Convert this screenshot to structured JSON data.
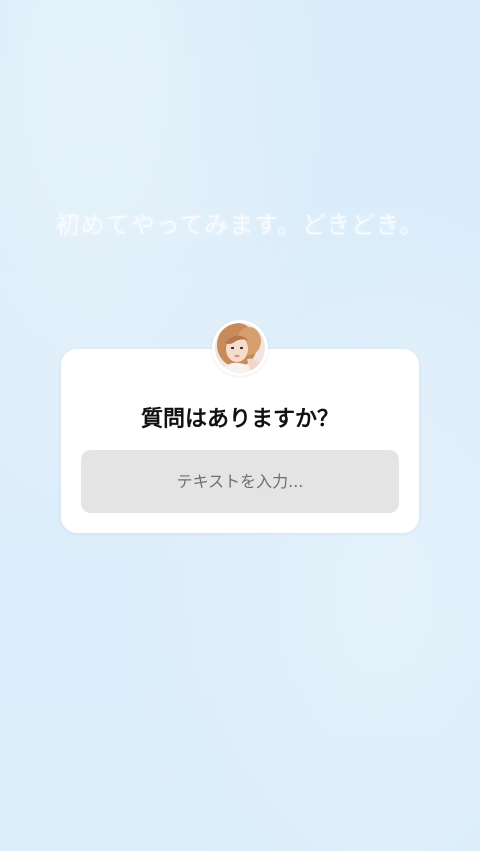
{
  "story": {
    "caption": "初めてやってみます。どきどき。"
  },
  "question_sticker": {
    "title": "質問はありますか？",
    "input_placeholder": "テキストを入力..."
  },
  "colors": {
    "background": "#dbeefa",
    "card": "#ffffff",
    "input_fill": "#e4e4e4"
  }
}
